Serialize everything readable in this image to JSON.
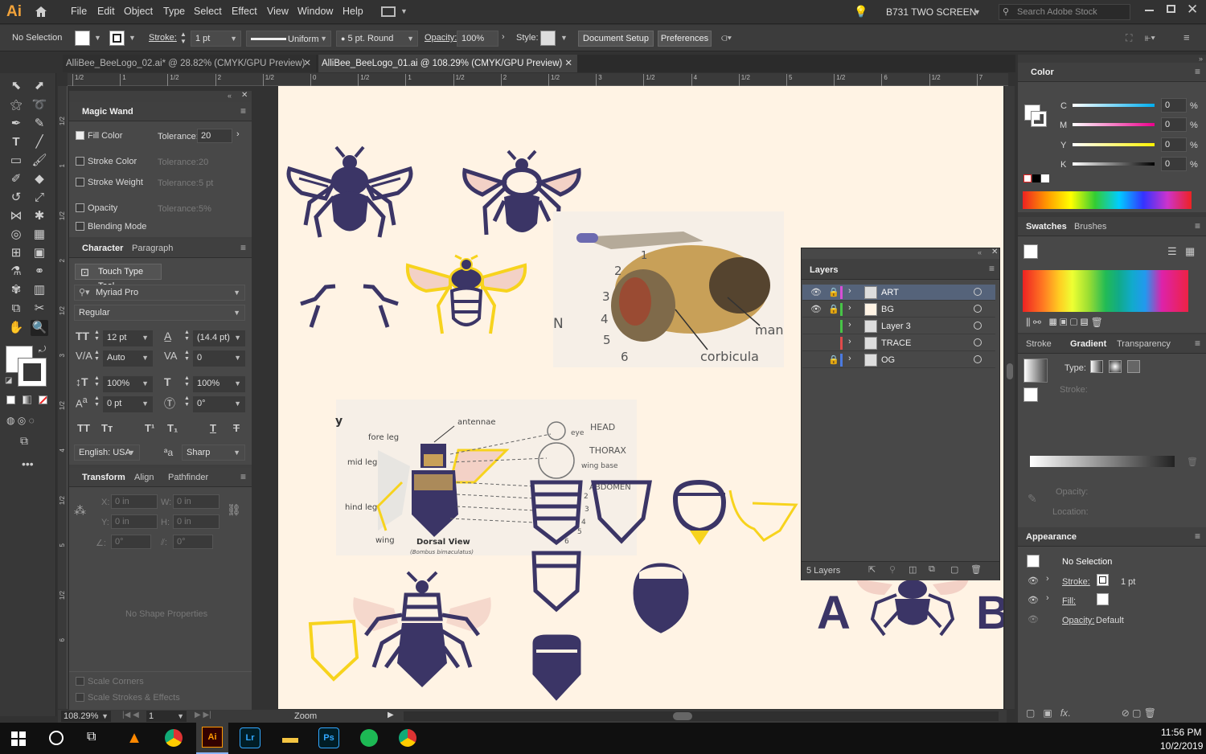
{
  "app": {
    "logo": "Ai",
    "menu": [
      "File",
      "Edit",
      "Object",
      "Type",
      "Select",
      "Effect",
      "View",
      "Window",
      "Help"
    ],
    "workspace": "B731 TWO SCREEN",
    "search_placeholder": "Search Adobe Stock"
  },
  "control": {
    "selection": "No Selection",
    "stroke_label": "Stroke:",
    "stroke_value": "1 pt",
    "profile": "Uniform",
    "brush": "5 pt. Round",
    "opacity_label": "Opacity:",
    "opacity_value": "100%",
    "style_label": "Style:",
    "doc_setup": "Document Setup",
    "preferences": "Preferences"
  },
  "tabs": [
    {
      "label": "AlliBee_BeeLogo_02.ai* @ 28.82% (CMYK/GPU Preview)"
    },
    {
      "label": "AlliBee_BeeLogo_01.ai @ 108.29% (CMYK/GPU Preview)"
    }
  ],
  "ruler": {
    "h": [
      "1/2",
      "1",
      "1/2",
      "2",
      "1/2",
      "0",
      "1/2",
      "1",
      "1/2",
      "2",
      "1/2",
      "3",
      "1/2",
      "4",
      "1/2",
      "5",
      "1/2",
      "6",
      "1/2",
      "7",
      "1/2"
    ],
    "v": [
      "1/2",
      "1",
      "1/2",
      "2",
      "1/2",
      "3",
      "1/2",
      "4",
      "1/2",
      "5",
      "1/2",
      "6"
    ]
  },
  "magic_wand": {
    "title": "Magic Wand",
    "rows": [
      {
        "label": "Fill Color",
        "checked": true,
        "tol": "Tolerance:",
        "val": "20"
      },
      {
        "label": "Stroke Color",
        "checked": false,
        "tol": "Tolerance:",
        "val": "20"
      },
      {
        "label": "Stroke Weight",
        "checked": false,
        "tol": "Tolerance:",
        "val": "5 pt"
      },
      {
        "label": "Opacity",
        "checked": false,
        "tol": "Tolerance:",
        "val": "5%"
      },
      {
        "label": "Blending Mode",
        "checked": false
      }
    ]
  },
  "character": {
    "tab1": "Character",
    "tab2": "Paragraph",
    "touch": "Touch Type Tool",
    "font": "Myriad Pro",
    "style": "Regular",
    "size": "12 pt",
    "leading": "(14.4 pt)",
    "kerning": "Auto",
    "tracking": "0",
    "vscale": "100%",
    "hscale": "100%",
    "baseline": "0 pt",
    "rotation": "0°",
    "language": "English: USA",
    "aa_label": "ªa",
    "aa": "Sharp"
  },
  "transform": {
    "tab1": "Transform",
    "tab2": "Align",
    "tab3": "Pathfinder",
    "x": "0 in",
    "y": "0 in",
    "w": "0 in",
    "h": "0 in",
    "angle": "0°",
    "shear": "0°",
    "no_shape": "No Shape Properties",
    "scale_corners": "Scale Corners",
    "scale_strokes": "Scale Strokes & Effects"
  },
  "layers": {
    "title": "Layers",
    "items": [
      {
        "name": "ART",
        "color": "#d64fd6"
      },
      {
        "name": "BG",
        "color": "#47c447"
      },
      {
        "name": "Layer 3",
        "color": "#47c447"
      },
      {
        "name": "TRACE",
        "color": "#e14b4b"
      },
      {
        "name": "OG",
        "color": "#4b7ae1"
      }
    ],
    "count": "5 Layers"
  },
  "color": {
    "title": "Color",
    "channels": [
      {
        "name": "C",
        "value": "0",
        "unit": "%"
      },
      {
        "name": "M",
        "value": "0",
        "unit": "%"
      },
      {
        "name": "Y",
        "value": "0",
        "unit": "%"
      },
      {
        "name": "K",
        "value": "0",
        "unit": "%"
      }
    ]
  },
  "swatches": {
    "tab1": "Swatches",
    "tab2": "Brushes"
  },
  "gradient": {
    "tab1": "Stroke",
    "tab2": "Gradient",
    "tab3": "Transparency",
    "type": "Type:",
    "stroke": "Stroke:",
    "opacity": "Opacity:",
    "location": "Location:"
  },
  "appearance": {
    "title": "Appearance",
    "selection": "No Selection",
    "stroke_label": "Stroke:",
    "stroke_value": "1 pt",
    "fill_label": "Fill:",
    "opacity_label": "Opacity:",
    "opacity_value": "Default"
  },
  "artwork": {
    "ref1_labels": [
      "1",
      "2",
      "3",
      "4",
      "5",
      "6",
      "man",
      "corbicula",
      "N"
    ],
    "ref2_labels": [
      "antennae",
      "fore leg",
      "mid leg",
      "hind leg",
      "wing",
      "Dorsal View",
      "(Bombus bimaculatus)",
      "HEAD",
      "THORAX",
      "ABDOMEN",
      "eye",
      "wing base",
      "y",
      "2",
      "3",
      "4",
      "5",
      "6"
    ],
    "letters": [
      "A",
      "B"
    ],
    "colors": {
      "navy": "#3b3566",
      "yellow": "#f7d31d",
      "pink": "#f3d1c6"
    }
  },
  "status": {
    "zoom": "108.29%",
    "page": "1",
    "tool": "Zoom"
  },
  "taskbar": {
    "time": "11:56 PM",
    "date": "10/2/2019"
  }
}
